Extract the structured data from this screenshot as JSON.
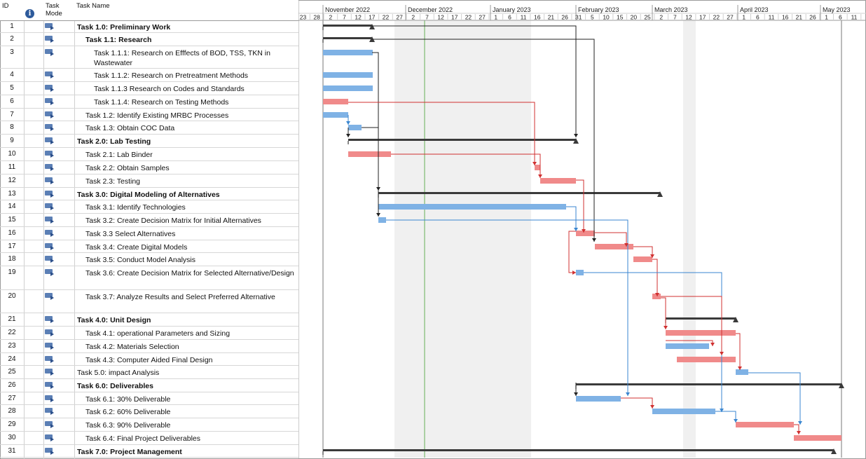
{
  "header": {
    "id": "ID",
    "info": "i",
    "task_mode_line1": "Task",
    "task_mode_line2": "Mode",
    "task_name": "Task Name"
  },
  "timescale": {
    "months": [
      {
        "label": "November 2022"
      },
      {
        "label": "December 2022"
      },
      {
        "label": "January 2023"
      },
      {
        "label": "February 2023"
      },
      {
        "label": "March 2023"
      },
      {
        "label": "April 2023"
      },
      {
        "label": "May 2023"
      }
    ],
    "days": [
      "23",
      "28",
      "2",
      "7",
      "12",
      "17",
      "22",
      "27",
      "2",
      "7",
      "12",
      "17",
      "22",
      "27",
      "1",
      "6",
      "11",
      "16",
      "21",
      "26",
      "31",
      "5",
      "10",
      "15",
      "20",
      "25",
      "2",
      "7",
      "12",
      "17",
      "22",
      "27",
      "1",
      "6",
      "11",
      "16",
      "21",
      "26",
      "1",
      "6",
      "11"
    ]
  },
  "tasks": [
    {
      "id": "1",
      "name": "Task 1.0: Preliminary Work",
      "bold": true,
      "indent": 0
    },
    {
      "id": "2",
      "name": "Task 1.1: Research",
      "bold": true,
      "indent": 1
    },
    {
      "id": "3",
      "name": "Task 1.1.1: Research on Efffects of BOD, TSS, TKN in Wastewater",
      "bold": false,
      "indent": 2
    },
    {
      "id": "4",
      "name": "Task 1.1.2: Research on Pretreatment Methods",
      "bold": false,
      "indent": 2
    },
    {
      "id": "5",
      "name": "Task 1.1.3 Research on Codes and Standards",
      "bold": false,
      "indent": 2
    },
    {
      "id": "6",
      "name": "Task 1.1.4: Research on Testing Methods",
      "bold": false,
      "indent": 2
    },
    {
      "id": "7",
      "name": "Task 1.2: Identify Existing MRBC Processes",
      "bold": false,
      "indent": 1
    },
    {
      "id": "8",
      "name": "Task 1.3: Obtain COC Data",
      "bold": false,
      "indent": 1
    },
    {
      "id": "9",
      "name": "Task 2.0: Lab Testing",
      "bold": true,
      "indent": 0
    },
    {
      "id": "10",
      "name": "Task 2.1: Lab Binder",
      "bold": false,
      "indent": 1
    },
    {
      "id": "11",
      "name": "Task 2.2: Obtain Samples",
      "bold": false,
      "indent": 1
    },
    {
      "id": "12",
      "name": "Task 2.3: Testing",
      "bold": false,
      "indent": 1
    },
    {
      "id": "13",
      "name": "Task 3.0: Digital Modeling of Alternatives",
      "bold": true,
      "indent": 0
    },
    {
      "id": "14",
      "name": "Task 3.1: Identify Technologies",
      "bold": false,
      "indent": 1
    },
    {
      "id": "15",
      "name": "Task 3.2: Create Decision Matrix for Initial Alternatives",
      "bold": false,
      "indent": 1
    },
    {
      "id": "16",
      "name": "Task 3.3 Select Alternatives",
      "bold": false,
      "indent": 1
    },
    {
      "id": "17",
      "name": "Task 3.4: Create Digital Models",
      "bold": false,
      "indent": 1
    },
    {
      "id": "18",
      "name": "Task 3.5: Conduct Model Analysis",
      "bold": false,
      "indent": 1
    },
    {
      "id": "19",
      "name": "Task 3.6: Create Decision Matrix for Selected Alternative/Design",
      "bold": false,
      "indent": 1
    },
    {
      "id": "20",
      "name": "Task 3.7: Analyze Results and Select Preferred Alternative",
      "bold": false,
      "indent": 1
    },
    {
      "id": "21",
      "name": "Task 4.0: Unit Design",
      "bold": true,
      "indent": 0
    },
    {
      "id": "22",
      "name": "Task 4.1: operational Parameters and Sizing",
      "bold": false,
      "indent": 1
    },
    {
      "id": "23",
      "name": "Task 4.2: Materials Selection",
      "bold": false,
      "indent": 1
    },
    {
      "id": "24",
      "name": "Task 4.3: Computer Aided Final Design",
      "bold": false,
      "indent": 1
    },
    {
      "id": "25",
      "name": "Task 5.0: impact Analysis",
      "bold": false,
      "indent": 0
    },
    {
      "id": "26",
      "name": "Task 6.0: Deliverables",
      "bold": true,
      "indent": 0
    },
    {
      "id": "27",
      "name": "Task 6.1: 30% Deliverable",
      "bold": false,
      "indent": 1
    },
    {
      "id": "28",
      "name": "Task 6.2: 60% Deliverable",
      "bold": false,
      "indent": 1
    },
    {
      "id": "29",
      "name": "Task 6.3: 90% Deliverable",
      "bold": false,
      "indent": 1
    },
    {
      "id": "30",
      "name": "Task 6.4: Final Project Deliverables",
      "bold": false,
      "indent": 1
    },
    {
      "id": "31",
      "name": "Task 7.0: Project Management",
      "bold": true,
      "indent": 0
    }
  ],
  "colors": {
    "normal_bar": "#7fb2e5",
    "critical_bar": "#f08a8a",
    "summary_bar": "#3a3a3a",
    "critical_link": "#d03030",
    "normal_link": "#3a86d0",
    "summary_link": "#222222",
    "today_line": "#86c07a",
    "nonworking": "#f0f0f0"
  }
}
